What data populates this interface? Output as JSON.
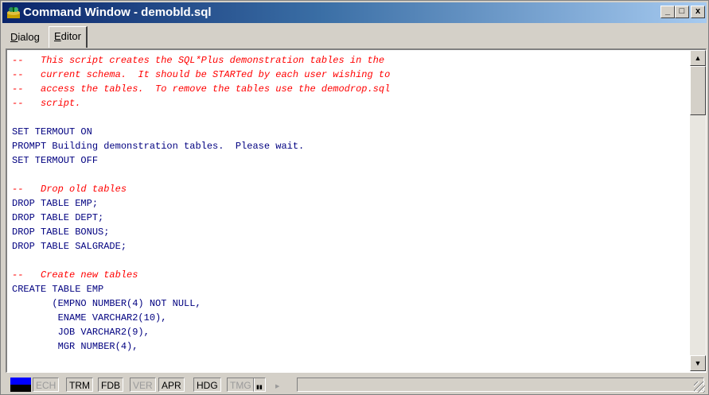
{
  "window": {
    "title": "Command Window - demobld.sql",
    "controls": {
      "minimize": "_",
      "maximize": "□",
      "close": "x"
    }
  },
  "tabs": [
    {
      "label_underlined": "D",
      "label_rest": "ialog"
    },
    {
      "label_underlined": "E",
      "label_rest": "ditor"
    }
  ],
  "editor": {
    "lines": [
      {
        "text": "--   This script creates the SQL*Plus demonstration tables in the",
        "kind": "comment"
      },
      {
        "text": "--   current schema.  It should be STARTed by each user wishing to",
        "kind": "comment"
      },
      {
        "text": "--   access the tables.  To remove the tables use the demodrop.sql",
        "kind": "comment"
      },
      {
        "text": "--   script.",
        "kind": "comment"
      },
      {
        "text": "",
        "kind": "code"
      },
      {
        "text": "SET TERMOUT ON",
        "kind": "code"
      },
      {
        "text": "PROMPT Building demonstration tables.  Please wait.",
        "kind": "code"
      },
      {
        "text": "SET TERMOUT OFF",
        "kind": "code"
      },
      {
        "text": "",
        "kind": "code"
      },
      {
        "text": "--   Drop old tables",
        "kind": "comment"
      },
      {
        "text": "DROP TABLE EMP;",
        "kind": "code"
      },
      {
        "text": "DROP TABLE DEPT;",
        "kind": "code"
      },
      {
        "text": "DROP TABLE BONUS;",
        "kind": "code"
      },
      {
        "text": "DROP TABLE SALGRADE;",
        "kind": "code"
      },
      {
        "text": "",
        "kind": "code"
      },
      {
        "text": "--   Create new tables",
        "kind": "comment"
      },
      {
        "text": "CREATE TABLE EMP",
        "kind": "code"
      },
      {
        "text": "       (EMPNO NUMBER(4) NOT NULL,",
        "kind": "code"
      },
      {
        "text": "        ENAME VARCHAR2(10),",
        "kind": "code"
      },
      {
        "text": "        JOB VARCHAR2(9),",
        "kind": "code"
      },
      {
        "text": "        MGR NUMBER(4),",
        "kind": "code"
      }
    ],
    "colors": {
      "comment": "#ff0000",
      "code": "#000080",
      "background": "#ffffff"
    }
  },
  "status": {
    "indicators": [
      {
        "label": "ECH",
        "active": false
      },
      {
        "label": "TRM",
        "active": true
      },
      {
        "label": "FDB",
        "active": true
      },
      {
        "label": "VER",
        "active": false
      },
      {
        "label": "APR",
        "active": true
      },
      {
        "label": "HDG",
        "active": true
      },
      {
        "label": "TMG",
        "active": false
      }
    ],
    "timer": {
      "pause": "▮▮",
      "play": "▶"
    }
  },
  "theme": {
    "titlebar_start": "#0a246a",
    "titlebar_end": "#a6caf0",
    "chrome": "#d4d0c8"
  }
}
